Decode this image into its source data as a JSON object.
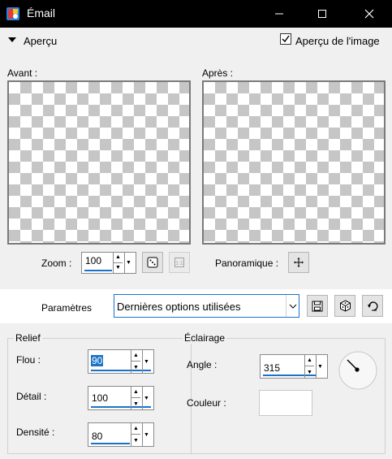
{
  "window": {
    "title": "Émail",
    "minimize_glyph": "—",
    "maximize_glyph": "☐",
    "close_glyph": "✕"
  },
  "preview": {
    "section_label": "Aperçu",
    "show_image_label": "Aperçu de l'image",
    "show_image_checked": true,
    "before_label": "Avant :",
    "after_label": "Après :",
    "zoom_label": "Zoom :",
    "zoom_value": "100",
    "pan_label": "Panoramique :"
  },
  "params": {
    "label": "Paramètres",
    "selected": "Dernières options utilisées"
  },
  "relief": {
    "title": "Relief",
    "flou_label": "Flou :",
    "flou_value": "90",
    "detail_label": "Détail :",
    "detail_value": "100",
    "densite_label": "Densité :",
    "densite_value": "80"
  },
  "lighting": {
    "title": "Éclairage",
    "angle_label": "Angle :",
    "angle_value": "315",
    "couleur_label": "Couleur :",
    "couleur_value": "#ffffff"
  },
  "icons": {
    "app": "paintshop-app-icon",
    "collapse": "collapse-arrow-icon",
    "checkmark": "checkmark-icon",
    "randomize": "dice-icon",
    "actual_size": "actual-size-icon",
    "pan": "move-cross-icon",
    "save": "save-icon",
    "randomize_params": "dice-icon",
    "reset": "reset-icon",
    "angle_dial": "angle-dial-icon"
  },
  "colors": {
    "titlebar": "#000000",
    "accent": "#1a73c8",
    "selected_value_bg": "#1a73c8"
  }
}
